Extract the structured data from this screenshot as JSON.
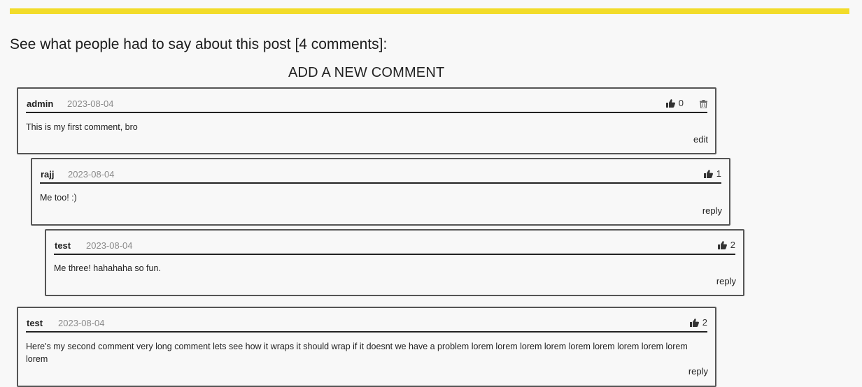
{
  "page": {
    "heading": "See what people had to say about this post [4 comments]:",
    "add_comment_label": "ADD A NEW COMMENT",
    "accent_color": "#f2dc2a"
  },
  "comments": [
    {
      "author": "admin",
      "date": "2023-08-04",
      "likes": "0",
      "text": "This is my first comment, bro",
      "action": "edit",
      "can_delete": true
    },
    {
      "author": "rajj",
      "date": "2023-08-04",
      "likes": "1",
      "text": "Me too! :)",
      "action": "reply"
    },
    {
      "author": "test",
      "date": "2023-08-04",
      "likes": "2",
      "text": "Me three! hahahaha so fun.",
      "action": "reply"
    },
    {
      "author": "test",
      "date": "2023-08-04",
      "likes": "2",
      "text": "Here's my second comment very long comment lets see how it wraps it should wrap if it doesnt we have a problem lorem lorem lorem lorem lorem lorem lorem lorem lorem lorem",
      "action": "reply"
    }
  ]
}
